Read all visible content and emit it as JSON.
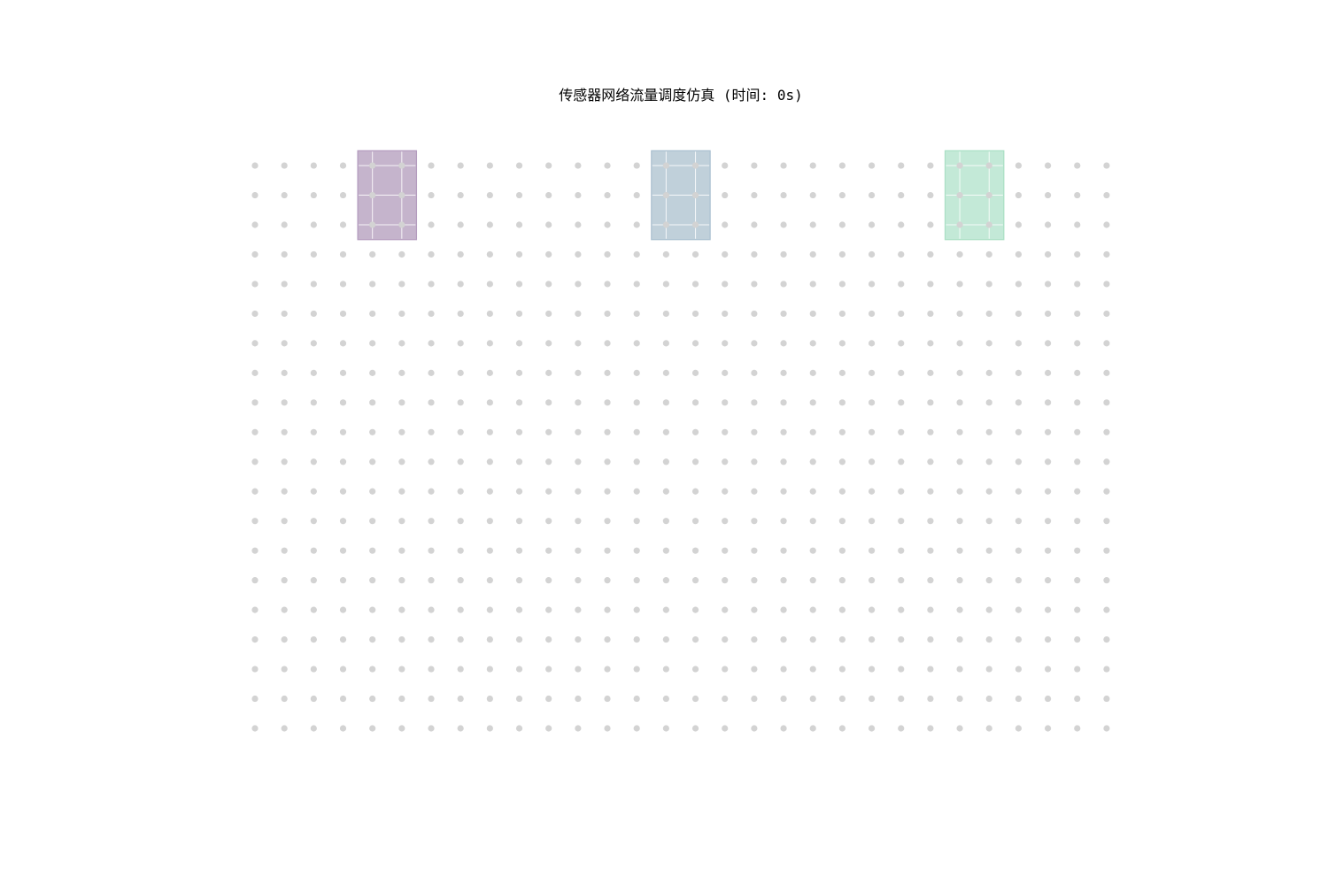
{
  "chart_data": {
    "type": "scatter",
    "title": "传感器网络流量调度仿真 (时间: 0s)",
    "xlabel": "",
    "ylabel": "",
    "grid": false,
    "axes_visible": false,
    "sensor_nodes": {
      "x_range": [
        0,
        29
      ],
      "y_range": [
        0,
        19
      ],
      "columns": 30,
      "rows": 20,
      "color": "#d3d3d3"
    },
    "regions": [
      {
        "x": [
          4,
          5
        ],
        "y": [
          17,
          19
        ],
        "fill": "#c5b4cc",
        "edge": "#b39bbd"
      },
      {
        "x": [
          14,
          15
        ],
        "y": [
          17,
          19
        ],
        "fill": "#c0d0da",
        "edge": "#a9bfcf"
      },
      {
        "x": [
          24,
          25
        ],
        "y": [
          17,
          19
        ],
        "fill": "#c3e9d7",
        "edge": "#a9dfc4"
      }
    ]
  }
}
